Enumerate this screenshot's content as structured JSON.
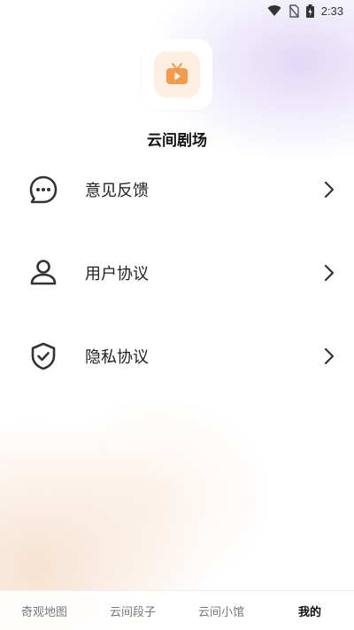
{
  "status_bar": {
    "time": "2:33",
    "icons": [
      "wifi-icon",
      "no-sim-icon",
      "battery-charging-icon"
    ]
  },
  "app": {
    "name": "云间剧场",
    "icon": "tv-play-icon",
    "accent_color": "#f39a4c"
  },
  "menu": {
    "items": [
      {
        "label": "意见反馈",
        "icon": "chat-bubble-icon"
      },
      {
        "label": "用户协议",
        "icon": "user-icon"
      },
      {
        "label": "隐私协议",
        "icon": "shield-check-icon"
      }
    ]
  },
  "tab_bar": {
    "tabs": [
      {
        "label": "奇观地图",
        "active": false
      },
      {
        "label": "云间段子",
        "active": false
      },
      {
        "label": "云间小馆",
        "active": false
      },
      {
        "label": "我的",
        "active": true
      }
    ]
  }
}
